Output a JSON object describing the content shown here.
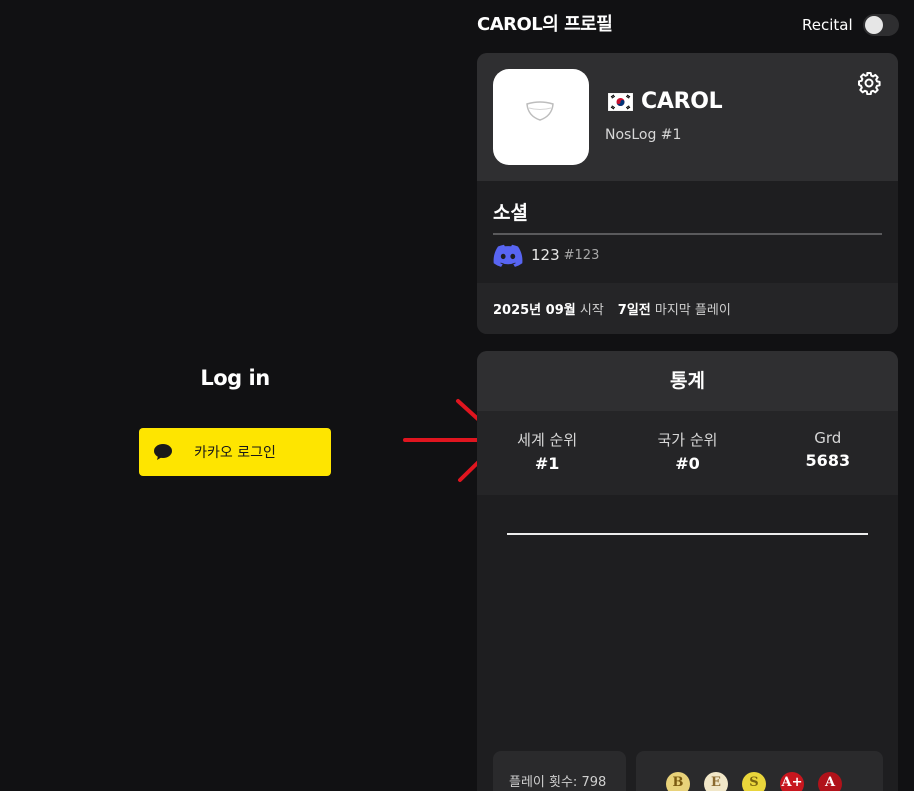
{
  "login": {
    "title": "Log in",
    "kakao_button": "카카오 로그인"
  },
  "header": {
    "profile_title": "CAROL의 프로필",
    "recital_label": "Recital",
    "recital_on": false
  },
  "profile": {
    "flag": "korea-flag-icon",
    "name": "CAROL",
    "tag": "NosLog #1",
    "social_title": "소셜",
    "discord_name": "123",
    "discord_id": "#123",
    "start_date": "2025년 09월",
    "start_suffix": "시작",
    "last_played": "7일전",
    "last_played_suffix": "마지막 플레이"
  },
  "stats": {
    "title": "통계",
    "items": [
      {
        "label": "세계 순위",
        "value": "#1"
      },
      {
        "label": "국가 순위",
        "value": "#0"
      },
      {
        "label": "Grd",
        "value": "5683"
      }
    ],
    "play_count": "플레이 횟수: 798",
    "badges": [
      {
        "letter": "B",
        "bg": "#e8d27a",
        "fg": "#7a5a10"
      },
      {
        "letter": "E",
        "bg": "#f1e7c8",
        "fg": "#8a6a30"
      },
      {
        "letter": "S",
        "bg": "#e9d53b",
        "fg": "#7a6410"
      },
      {
        "letter": "A+",
        "bg": "#c8161e",
        "fg": "#ffffff"
      },
      {
        "letter": "A",
        "bg": "#b0121a",
        "fg": "#ffffff"
      }
    ]
  },
  "colors": {
    "kakao": "#fee500",
    "arrow": "#e0151f",
    "discord": "#5865f2"
  }
}
